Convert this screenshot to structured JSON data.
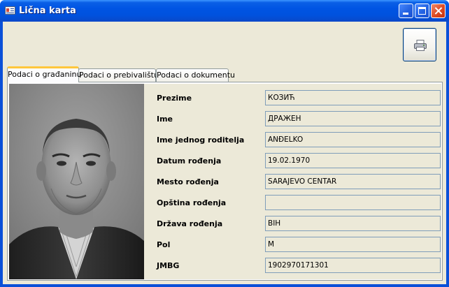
{
  "window": {
    "title": "Lična karta",
    "icon": "id-card-icon",
    "controls": [
      "minimize-icon",
      "maximize-icon",
      "close-icon"
    ]
  },
  "toolbar": {
    "print_icon": "printer-icon"
  },
  "tabs": [
    {
      "label": "Podaci o građaninu",
      "active": true
    },
    {
      "label": "Podaci o prebivalištu",
      "active": false
    },
    {
      "label": "Podaci o dokumentu",
      "active": false
    }
  ],
  "fields": [
    {
      "label": "Prezime",
      "value": "КОЗИЋ"
    },
    {
      "label": "Ime",
      "value": "ДРАЖЕН"
    },
    {
      "label": "Ime jednog roditelja",
      "value": "ANĐELKO"
    },
    {
      "label": "Datum rođenja",
      "value": "19.02.1970"
    },
    {
      "label": "Mesto rođenja",
      "value": "SARAJEVO  CENTAR"
    },
    {
      "label": "Opština rođenja",
      "value": ""
    },
    {
      "label": "Država rođenja",
      "value": "BIH"
    },
    {
      "label": "Pol",
      "value": "M"
    },
    {
      "label": "JMBG",
      "value": "1902970171301"
    }
  ],
  "colors": {
    "titlebar": "#0054e3",
    "window_bg": "#ece9d8",
    "active_tab_accent": "#ffc73c",
    "field_border": "#7f9db9"
  }
}
